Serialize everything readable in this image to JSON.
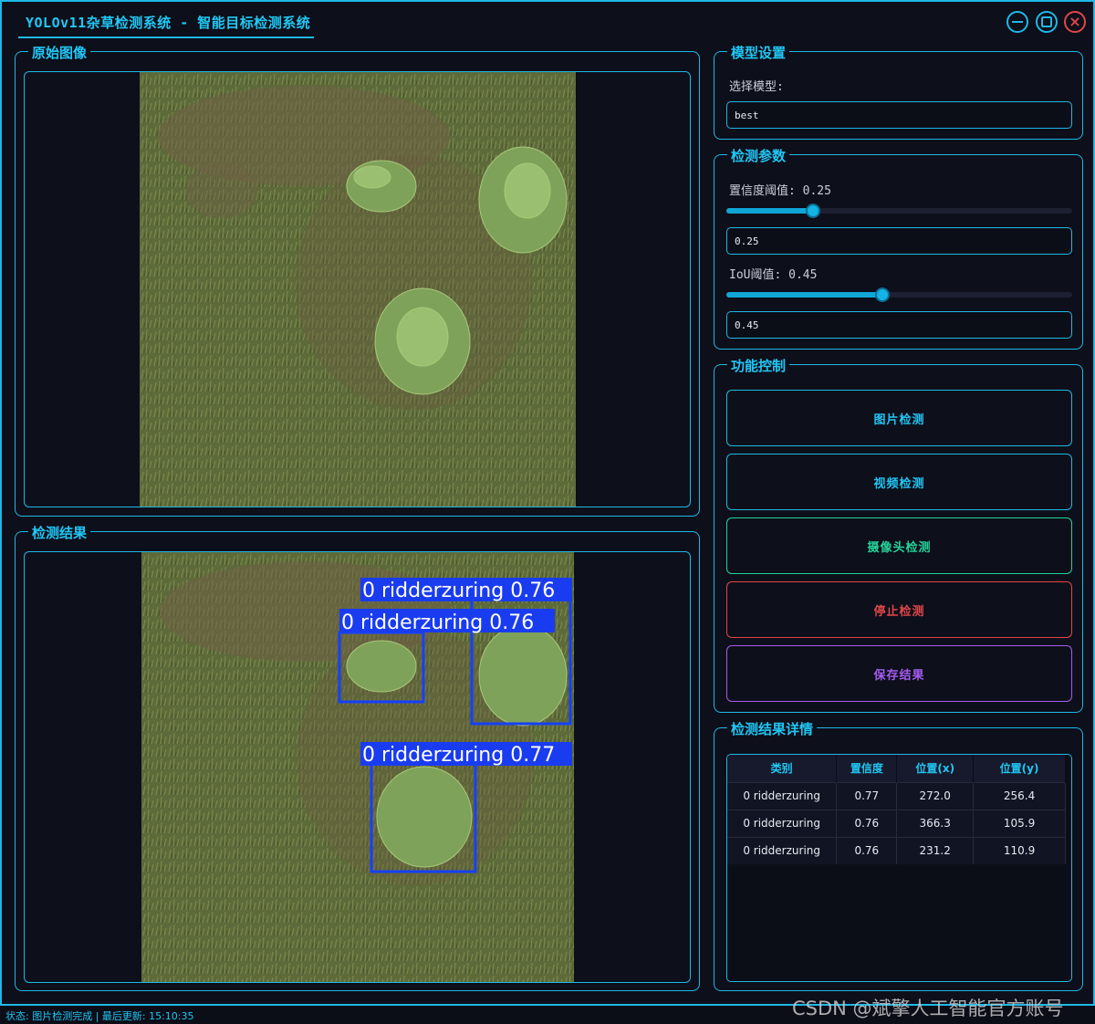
{
  "app": {
    "title": "YOLOv11杂草检测系统 - 智能目标检测系统"
  },
  "panels": {
    "original": {
      "title": "原始图像"
    },
    "result": {
      "title": "检测结果"
    }
  },
  "detections_overlay": [
    {
      "label": "0 ridderzuring 0.76"
    },
    {
      "label": "0 ridderzuring 0.76"
    },
    {
      "label": "0 ridderzuring 0.77"
    }
  ],
  "model_settings": {
    "title": "模型设置",
    "select_label": "选择模型:",
    "selected_model": "best"
  },
  "detection_params": {
    "title": "检测参数",
    "confidence_label": "置信度阈值: 0.25",
    "confidence_value": "0.25",
    "confidence_level": 0.25,
    "iou_label": "IoU阈值: 0.45",
    "iou_value": "0.45",
    "iou_level": 0.45
  },
  "controls": {
    "title": "功能控制",
    "image_detect": "图片检测",
    "video_detect": "视频检测",
    "camera_detect": "摄像头检测",
    "stop_detect": "停止检测",
    "save_results": "保存结果",
    "colors": {
      "image": "#21c6f4",
      "video": "#21c6f4",
      "camera": "#23d49a",
      "stop": "#e0464a",
      "save": "#a45cf0"
    }
  },
  "results_detail": {
    "title": "检测结果详情",
    "columns": [
      "类别",
      "置信度",
      "位置(x)",
      "位置(y)"
    ],
    "rows": [
      [
        "0 ridderzuring",
        "0.77",
        "272.0",
        "256.4"
      ],
      [
        "0 ridderzuring",
        "0.76",
        "366.3",
        "105.9"
      ],
      [
        "0 ridderzuring",
        "0.76",
        "231.2",
        "110.9"
      ]
    ]
  },
  "status_bar": {
    "text": "状态: 图片检测完成 | 最后更新: 15:10:35"
  },
  "watermark": "CSDN @斌擎人工智能官方账号"
}
